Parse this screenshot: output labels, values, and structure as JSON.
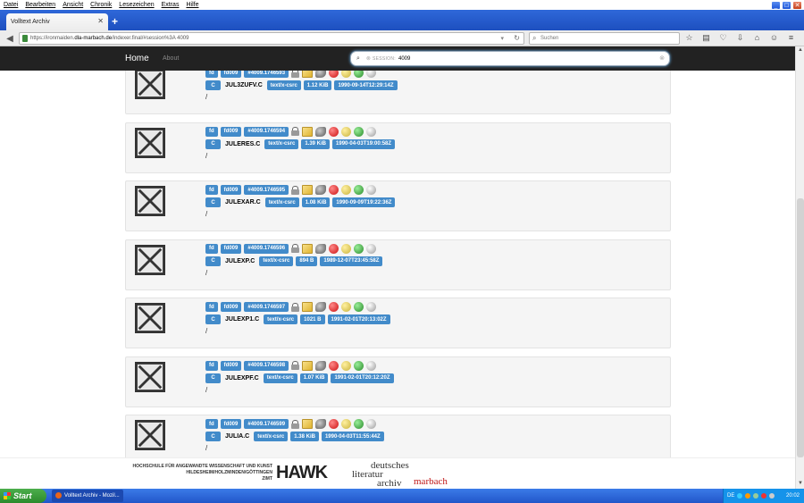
{
  "menu": [
    "Datei",
    "Bearbeiten",
    "Ansicht",
    "Chronik",
    "Lesezeichen",
    "Extras",
    "Hilfe"
  ],
  "tab": {
    "title": "Volltext Archiv"
  },
  "url": {
    "prefix": "https://ironmaiden.",
    "domain": "dla-marbach.de",
    "suffix": "/indexer.final/#session%3A 4009"
  },
  "search_placeholder": "Suchen",
  "site": {
    "brand": "Home",
    "about": "About"
  },
  "session": {
    "label": "SESSION:",
    "value": "4009"
  },
  "items": [
    {
      "fd": "fd",
      "id": "fd009",
      "ref": "#4009.1746593",
      "c": "C",
      "name": "JUL3ZUFV.C",
      "type": "text/x-csrc",
      "size": "1.12 KiB",
      "date": "1990-09-14T12:29:14Z",
      "path": "/"
    },
    {
      "fd": "fd",
      "id": "fd009",
      "ref": "#4009.1746594",
      "c": "C",
      "name": "JULERES.C",
      "type": "text/x-csrc",
      "size": "1.39 KiB",
      "date": "1990-04-03T19:00:58Z",
      "path": "/"
    },
    {
      "fd": "fd",
      "id": "fd009",
      "ref": "#4009.1746595",
      "c": "C",
      "name": "JULEXAR.C",
      "type": "text/x-csrc",
      "size": "1.08 KiB",
      "date": "1990-09-09T19:22:36Z",
      "path": "/"
    },
    {
      "fd": "fd",
      "id": "fd009",
      "ref": "#4009.1746596",
      "c": "C",
      "name": "JULEXP.C",
      "type": "text/x-csrc",
      "size": "894 B",
      "date": "1989-12-07T23:45:58Z",
      "path": "/"
    },
    {
      "fd": "fd",
      "id": "fd009",
      "ref": "#4009.1746597",
      "c": "C",
      "name": "JULEXP1.C",
      "type": "text/x-csrc",
      "size": "1021 B",
      "date": "1991-02-01T20:13:02Z",
      "path": "/"
    },
    {
      "fd": "fd",
      "id": "fd009",
      "ref": "#4009.1746598",
      "c": "C",
      "name": "JULEXPF.C",
      "type": "text/x-csrc",
      "size": "1.07 KiB",
      "date": "1991-02-01T20:12:20Z",
      "path": "/"
    },
    {
      "fd": "fd",
      "id": "fd009",
      "ref": "#4009.1746599",
      "c": "C",
      "name": "JULIA.C",
      "type": "text/x-csrc",
      "size": "1.38 KiB",
      "date": "1990-04-03T11:55:44Z",
      "path": "/"
    }
  ],
  "footer": {
    "hawk_line1": "HOCHSCHULE FÜR ANGEWANDTE WISSENSCHAFT UND KUNST",
    "hawk_line2": "HILDESHEIM/HOLZMINDEN/GÖTTINGEN",
    "hawk_line3": "ZIMT",
    "hawk_logo": "HAWK",
    "dla_line1": "deutsches",
    "dla_line2": "literatur",
    "dla_line3": "archiv",
    "dla_line4": "marbach"
  },
  "taskbar": {
    "start": "Start",
    "task": "Volltext Archiv - Mozil...",
    "lang": "DE",
    "clock": "20:02"
  },
  "colors": {
    "label_blue": "#428bca",
    "header_bg": "#222222",
    "taskbar_blue": "#2256c9"
  }
}
